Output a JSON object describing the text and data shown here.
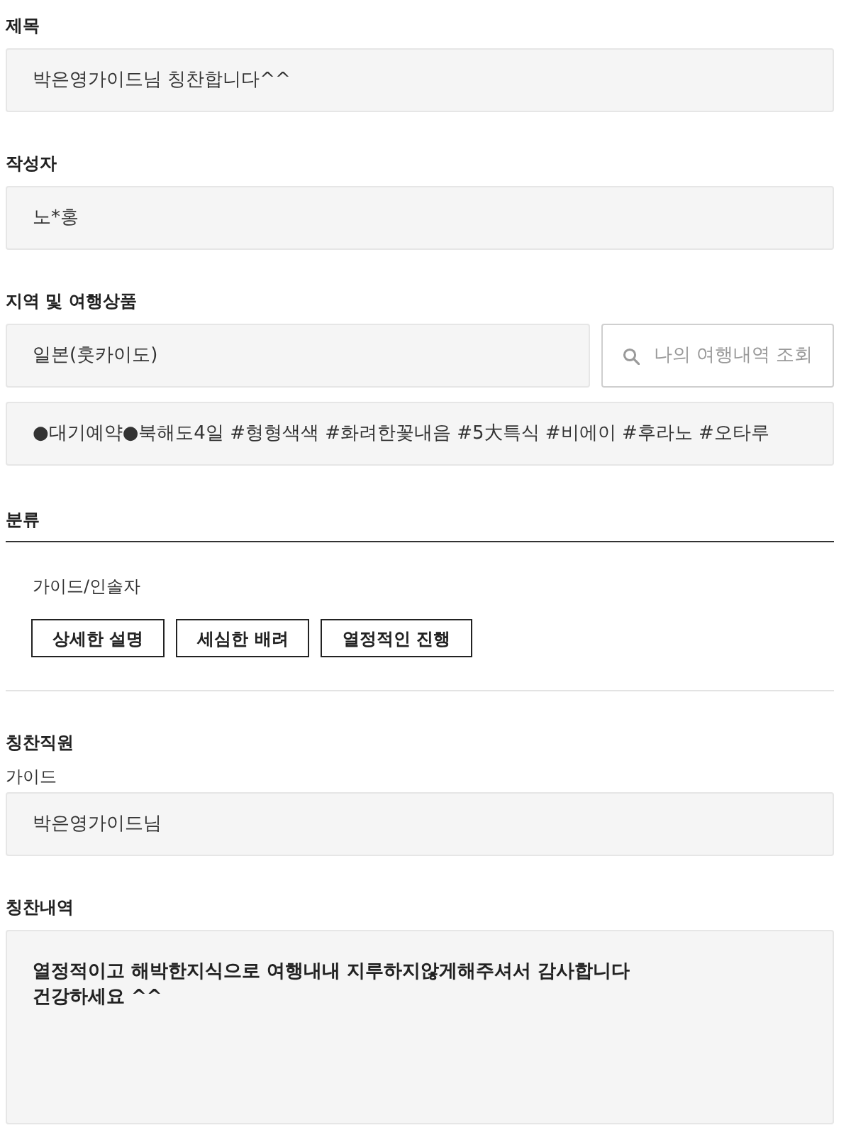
{
  "title_field": {
    "label": "제목",
    "value": "박은영가이드님 칭찬합니다^^"
  },
  "author_field": {
    "label": "작성자",
    "value": "노*홍"
  },
  "region_product": {
    "label": "지역 및 여행상품",
    "region": "일본(훗카이도)",
    "search_button": "나의 여행내역 조회",
    "product": "●대기예약●북해도4일 #형형색색 #화려한꽃내음 #5大특식 #비에이 #후라노 #오타루"
  },
  "category": {
    "label": "분류",
    "group": "가이드/인솔자",
    "tags": [
      "상세한 설명",
      "세심한 배려",
      "열정적인 진행"
    ]
  },
  "staff": {
    "label": "칭찬직원",
    "role": "가이드",
    "value": "박은영가이드님"
  },
  "content": {
    "label": "칭찬내역",
    "value": "열정적이고 해박한지식으로 여행내내 지루하지않게해주셔서 감사합니다\n건강하세요 ^^"
  }
}
